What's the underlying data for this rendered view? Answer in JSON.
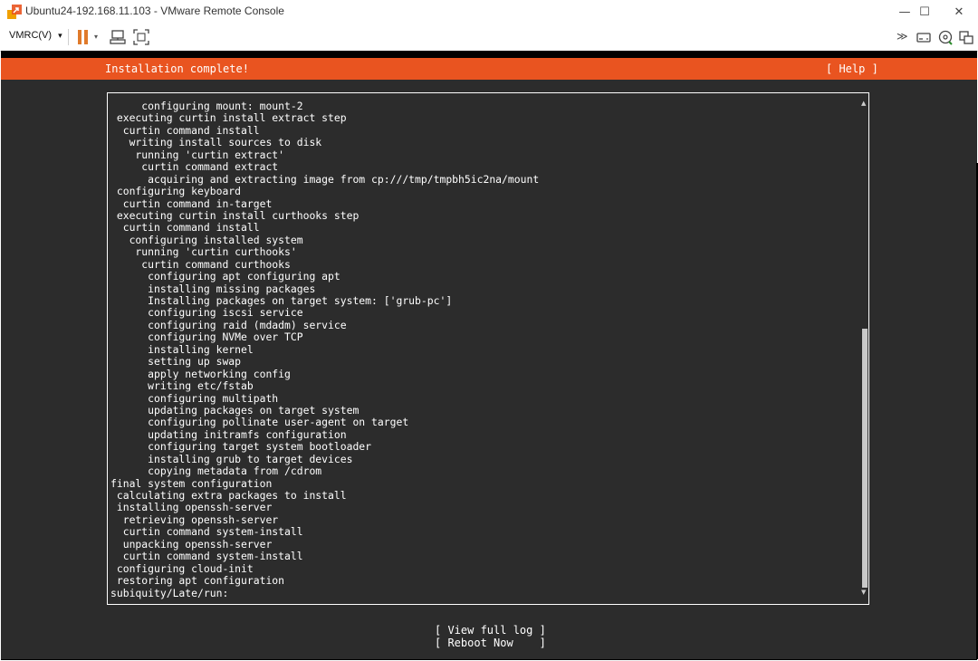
{
  "window": {
    "title": "Ubuntu24-192.168.11.103 - VMware Remote Console",
    "minimize_label": "—",
    "maximize_label": "☐",
    "close_label": "✕"
  },
  "toolbar": {
    "menu_label": "VMRC(V)",
    "menu_arrow": "▾",
    "pause_arrow": "▾",
    "more_label": "≫"
  },
  "installer": {
    "header_title": "Installation complete!",
    "help_label": "[ Help ]",
    "log_lines": [
      "     configuring mount: mount-2",
      " executing curtin install extract step",
      "  curtin command install",
      "   writing install sources to disk",
      "    running 'curtin extract'",
      "     curtin command extract",
      "      acquiring and extracting image from cp:///tmp/tmpbh5ic2na/mount",
      " configuring keyboard",
      "  curtin command in-target",
      " executing curtin install curthooks step",
      "  curtin command install",
      "   configuring installed system",
      "    running 'curtin curthooks'",
      "     curtin command curthooks",
      "      configuring apt configuring apt",
      "      installing missing packages",
      "      Installing packages on target system: ['grub-pc']",
      "      configuring iscsi service",
      "      configuring raid (mdadm) service",
      "      configuring NVMe over TCP",
      "      installing kernel",
      "      setting up swap",
      "      apply networking config",
      "      writing etc/fstab",
      "      configuring multipath",
      "      updating packages on target system",
      "      configuring pollinate user-agent on target",
      "      updating initramfs configuration",
      "      configuring target system bootloader",
      "      installing grub to target devices",
      "      copying metadata from /cdrom",
      "final system configuration",
      " calculating extra packages to install",
      " installing openssh-server",
      "  retrieving openssh-server",
      "  curtin command system-install",
      "  unpacking openssh-server",
      "  curtin command system-install",
      " configuring cloud-init",
      " restoring apt configuration",
      "subiquity/Late/run:"
    ],
    "scroll": {
      "thumb_start_fraction": 0.46,
      "thumb_end_fraction": 0.98
    },
    "scroll_up": "▲",
    "scroll_down": "▼",
    "view_log_label": "[ View full log ]",
    "reboot_label": "[ Reboot Now    ]"
  },
  "colors": {
    "accent": "#e95420",
    "terminal_bg": "#2c2c2c",
    "terminal_text": "#ffffff",
    "pause_icon": "#e07a2a"
  },
  "icons": [
    "vmware-logo-icon",
    "pause-icon",
    "send-ctrl-alt-del-icon",
    "fullscreen-icon",
    "removable-devices-icon",
    "cd-dvd-icon",
    "usb-icon"
  ]
}
